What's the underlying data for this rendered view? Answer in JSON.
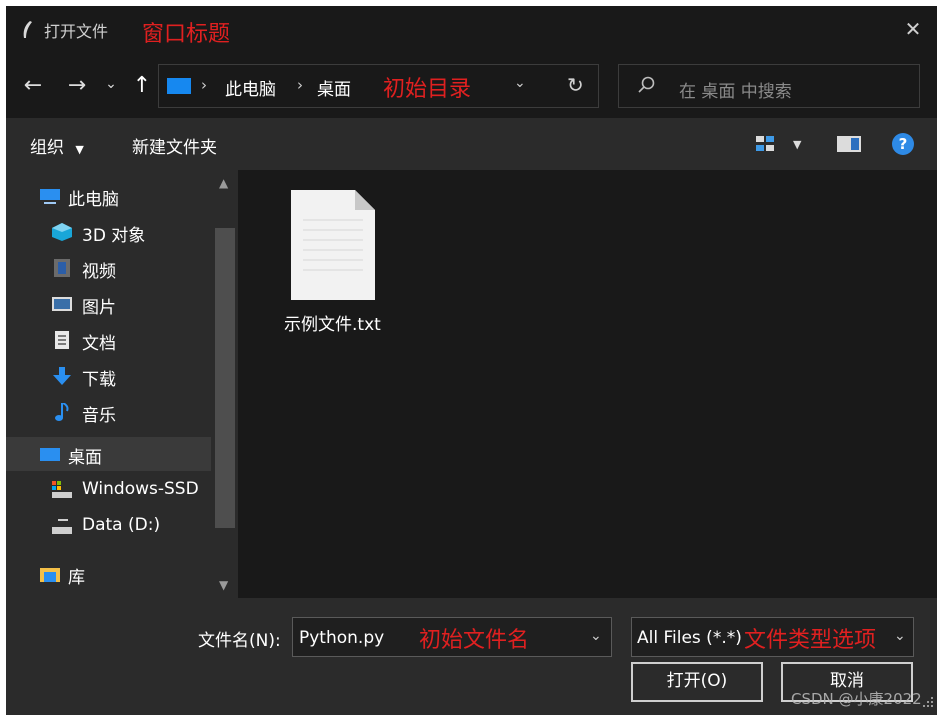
{
  "window": {
    "title": "打开文件",
    "close_glyph": "✕",
    "annotation_title": "窗口标题"
  },
  "nav": {
    "back_glyph": "←",
    "forward_glyph": "→",
    "recent_glyph": "⌄",
    "up_glyph": "↑",
    "breadcrumb": [
      "此电脑",
      "桌面"
    ],
    "breadcrumb_sep": "›",
    "annotation_dir": "初始目录",
    "dropdown_glyph": "⌄",
    "refresh_glyph": "↻",
    "search_placeholder": "在 桌面 中搜索"
  },
  "toolbar": {
    "organize": "组织",
    "new_folder": "新建文件夹",
    "help": "?"
  },
  "sidebar": {
    "items": [
      {
        "label": "此电脑",
        "icon": "computer-icon"
      },
      {
        "label": "3D 对象",
        "icon": "3d-objects-icon"
      },
      {
        "label": "视频",
        "icon": "video-icon"
      },
      {
        "label": "图片",
        "icon": "pictures-icon"
      },
      {
        "label": "文档",
        "icon": "documents-icon"
      },
      {
        "label": "下载",
        "icon": "download-icon"
      },
      {
        "label": "音乐",
        "icon": "music-icon"
      },
      {
        "label": "桌面",
        "icon": "desktop-icon",
        "selected": true
      },
      {
        "label": "Windows-SSD",
        "icon": "drive-icon"
      },
      {
        "label": "Data (D:)",
        "icon": "drive-icon"
      },
      {
        "label": "库",
        "icon": "library-icon"
      }
    ]
  },
  "content": {
    "files": [
      {
        "name": "示例文件.txt",
        "icon": "text-file-icon"
      }
    ]
  },
  "bottom": {
    "filename_label": "文件名(N):",
    "filename_value": "Python.py",
    "annotation_filename": "初始文件名",
    "filetype_value": "All Files (*.*)",
    "annotation_filetype": "文件类型选项",
    "open_button": "打开(O)",
    "cancel_button": "取消",
    "watermark": "CSDN @小康2022"
  },
  "colors": {
    "window_bg": "#191919",
    "panel_bg": "#2b2b2b",
    "accent_blue": "#1688f0",
    "annotation_red": "#e02020"
  }
}
